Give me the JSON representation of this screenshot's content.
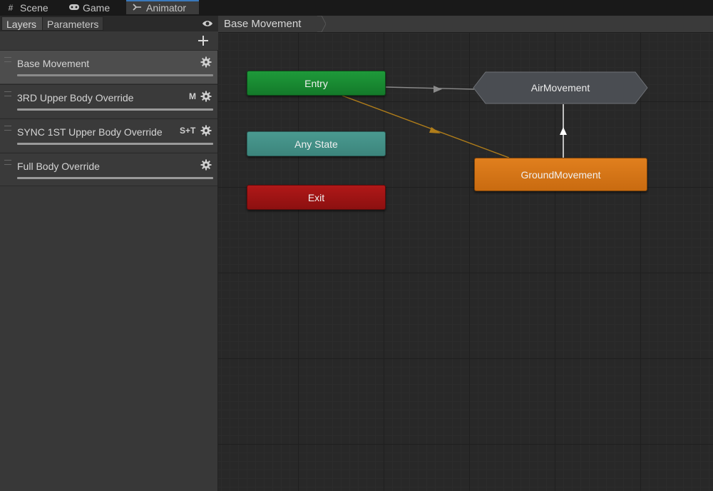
{
  "window_tabs": [
    {
      "label": "Scene",
      "icon": "hash-icon"
    },
    {
      "label": "Game",
      "icon": "gamepad-icon"
    },
    {
      "label": "Animator",
      "icon": "animator-icon"
    }
  ],
  "left_panel": {
    "subtabs": [
      "Layers",
      "Parameters"
    ],
    "layers": [
      {
        "name": "Base Movement",
        "flag": "",
        "selected": true
      },
      {
        "name": "3RD Upper Body Override",
        "flag": "M"
      },
      {
        "name": "SYNC 1ST Upper Body Override",
        "flag": "S+T"
      },
      {
        "name": "Full Body Override",
        "flag": ""
      }
    ]
  },
  "breadcrumb": {
    "current": "Base Movement"
  },
  "graph": {
    "nodes": {
      "entry": "Entry",
      "any_state": "Any State",
      "exit": "Exit",
      "air_movement": "AirMovement",
      "ground_movement": "GroundMovement"
    },
    "colors": {
      "entry": "#1e9a3a",
      "any_state": "#4a9a90",
      "exit": "#b01818",
      "default_state": "#e07f1e",
      "state": "#4a4d52",
      "transition_default": "#b07d1a",
      "transition": "#d0d0d0"
    }
  }
}
